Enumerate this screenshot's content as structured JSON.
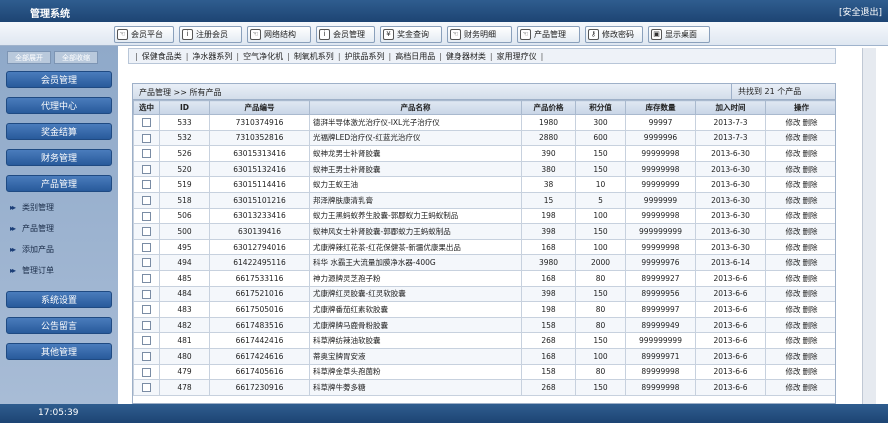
{
  "header": {
    "title": "管理系统",
    "logout": "[安全退出]"
  },
  "toolbar": [
    {
      "label": "会员平台",
      "icon": "hand-icon",
      "glyph": "☜"
    },
    {
      "label": "注册会员",
      "icon": "info-icon",
      "glyph": "i"
    },
    {
      "label": "网络结构",
      "icon": "hand-icon",
      "glyph": "☜"
    },
    {
      "label": "会员管理",
      "icon": "info-icon",
      "glyph": "i"
    },
    {
      "label": "奖金查询",
      "icon": "coin-icon",
      "glyph": "¥"
    },
    {
      "label": "财务明细",
      "icon": "hand-icon",
      "glyph": "☜"
    },
    {
      "label": "产品管理",
      "icon": "hand-icon",
      "glyph": "☜"
    },
    {
      "label": "修改密码",
      "icon": "key-icon",
      "glyph": "⚷"
    },
    {
      "label": "显示桌面",
      "icon": "desktop-icon",
      "glyph": "▣"
    }
  ],
  "sidebar": {
    "tabs": [
      "全部展开",
      "全部收缩"
    ],
    "items": [
      "会员管理",
      "代理中心",
      "奖金结算",
      "财务管理",
      "产品管理"
    ],
    "subitems": [
      "类别管理",
      "产品管理",
      "添加产品",
      "管理订单"
    ],
    "items_after": [
      "系统设置",
      "公告留言",
      "其他管理"
    ]
  },
  "categories": [
    "保健食品类",
    "净水器系列",
    "空气净化机",
    "制氧机系列",
    "护肤品系列",
    "高档日用品",
    "健身器材类",
    "家用理疗仪"
  ],
  "panel": {
    "breadcrumb": "产品管理 >> 所有产品",
    "count": "共找到 21 个产品"
  },
  "table": {
    "columns": [
      "选中",
      "ID",
      "产品编号",
      "产品名称",
      "产品价格",
      "积分值",
      "库存数量",
      "加入时间",
      "操作"
    ],
    "edit_label": "修改",
    "delete_label": "删除",
    "rows": [
      [
        "533",
        "7310374916",
        "德湃半导体激光治疗仪-IXL光子治疗仪",
        "1980",
        "300",
        "99997",
        "2013-7-3"
      ],
      [
        "532",
        "7310352816",
        "光福牌LED治疗仪-红蓝光治疗仪",
        "2880",
        "600",
        "9999996",
        "2013-7-3"
      ],
      [
        "526",
        "63015313416",
        "蚁神龙男士补肾胶囊",
        "390",
        "150",
        "99999998",
        "2013-6-30"
      ],
      [
        "520",
        "63015132416",
        "蚁神王男士补肾胶囊",
        "380",
        "150",
        "99999998",
        "2013-6-30"
      ],
      [
        "519",
        "63015114416",
        "蚁力王蚁王油",
        "38",
        "10",
        "99999999",
        "2013-6-30"
      ],
      [
        "518",
        "63015101216",
        "邦泽牌肤康清乳膏",
        "15",
        "5",
        "9999999",
        "2013-6-30"
      ],
      [
        "506",
        "63013233416",
        "蚁力王黑蚂蚁养生胶囊-郭郿蚁力王蚂蚁制品",
        "198",
        "100",
        "99999998",
        "2013-6-30"
      ],
      [
        "500",
        "630139416",
        "蚁神风女士补肾胶囊-郭郿蚁力王蚂蚁制品",
        "398",
        "150",
        "999999999",
        "2013-6-30"
      ],
      [
        "495",
        "63012794016",
        "尤康牌辣红花茶-红花保健茶-新疆优康果出品",
        "168",
        "100",
        "99999998",
        "2013-6-30"
      ],
      [
        "494",
        "61422495116",
        "科华 水霸王大流量加膜净水器-400G",
        "3980",
        "2000",
        "99999976",
        "2013-6-14"
      ],
      [
        "485",
        "6617533116",
        "神力源牌灵芝孢子粉",
        "168",
        "80",
        "89999927",
        "2013-6-6"
      ],
      [
        "484",
        "6617521016",
        "尤康牌红灵胶囊-红灵软胶囊",
        "398",
        "150",
        "89999956",
        "2013-6-6"
      ],
      [
        "483",
        "6617505016",
        "尤康牌番茄红素软胶囊",
        "198",
        "80",
        "89999997",
        "2013-6-6"
      ],
      [
        "482",
        "6617483516",
        "尤康牌牌马鹿骨粉胶囊",
        "158",
        "80",
        "89999949",
        "2013-6-6"
      ],
      [
        "481",
        "6617442416",
        "科草牌纺辣油软胶囊",
        "268",
        "150",
        "999999999",
        "2013-6-6"
      ],
      [
        "480",
        "6617424616",
        "蒂奥宝牌胃安液",
        "168",
        "100",
        "89999971",
        "2013-6-6"
      ],
      [
        "479",
        "6617405616",
        "科草牌金草头孢菌粉",
        "158",
        "80",
        "89999998",
        "2013-6-6"
      ],
      [
        "478",
        "6617230916",
        "科草牌牛蒡多糖",
        "268",
        "150",
        "89999998",
        "2013-6-6"
      ]
    ]
  },
  "footer": {
    "time": "17:05:39"
  }
}
